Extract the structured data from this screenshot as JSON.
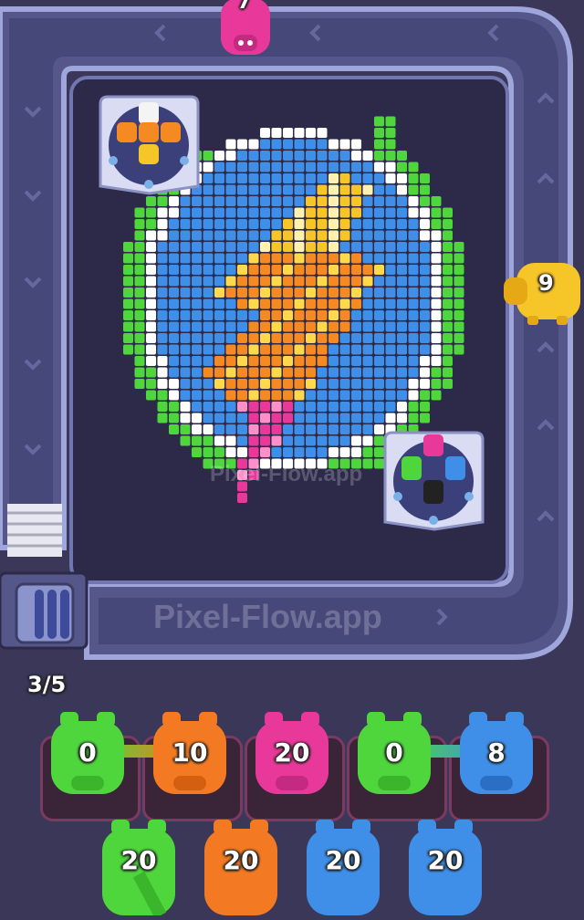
{
  "level": {
    "progress_label": "3/5",
    "progress_value": 3,
    "progress_total": 5
  },
  "watermark": {
    "board_text": "Pixel-Flow.app",
    "track_text": "Pixel-Flow.app"
  },
  "track_pigs": [
    {
      "id": "top",
      "color": "#e8399a",
      "count": "7"
    },
    {
      "id": "right",
      "color": "#f6c528",
      "count": "9"
    }
  ],
  "dispensers": [
    {
      "id": "top-left",
      "blocks": [
        "white",
        "orange",
        "orange",
        "orange",
        "yellow"
      ]
    },
    {
      "id": "bottom-right",
      "blocks": [
        "pink",
        "green",
        "blue",
        "black"
      ]
    }
  ],
  "queue_front": [
    {
      "color": "#4ed63c",
      "count": "0",
      "linked": true
    },
    {
      "color": "#f37a22",
      "count": "10",
      "linked": true
    },
    {
      "color": "#e8399a",
      "count": "20",
      "linked": false
    },
    {
      "color": "#4ed63c",
      "count": "0",
      "linked": true
    },
    {
      "color": "#3f8fe8",
      "count": "8",
      "linked": true
    }
  ],
  "queue_back": [
    {
      "color": "#4ed63c",
      "count": "20"
    },
    {
      "color": "#f37a22",
      "count": "20"
    },
    {
      "color": "#3f8fe8",
      "count": "20"
    },
    {
      "color": "#3f8fe8",
      "count": "20"
    }
  ],
  "colors": {
    "track": "#8890c8",
    "inner_panel": "#2c2a48",
    "background": "#3a3758"
  }
}
